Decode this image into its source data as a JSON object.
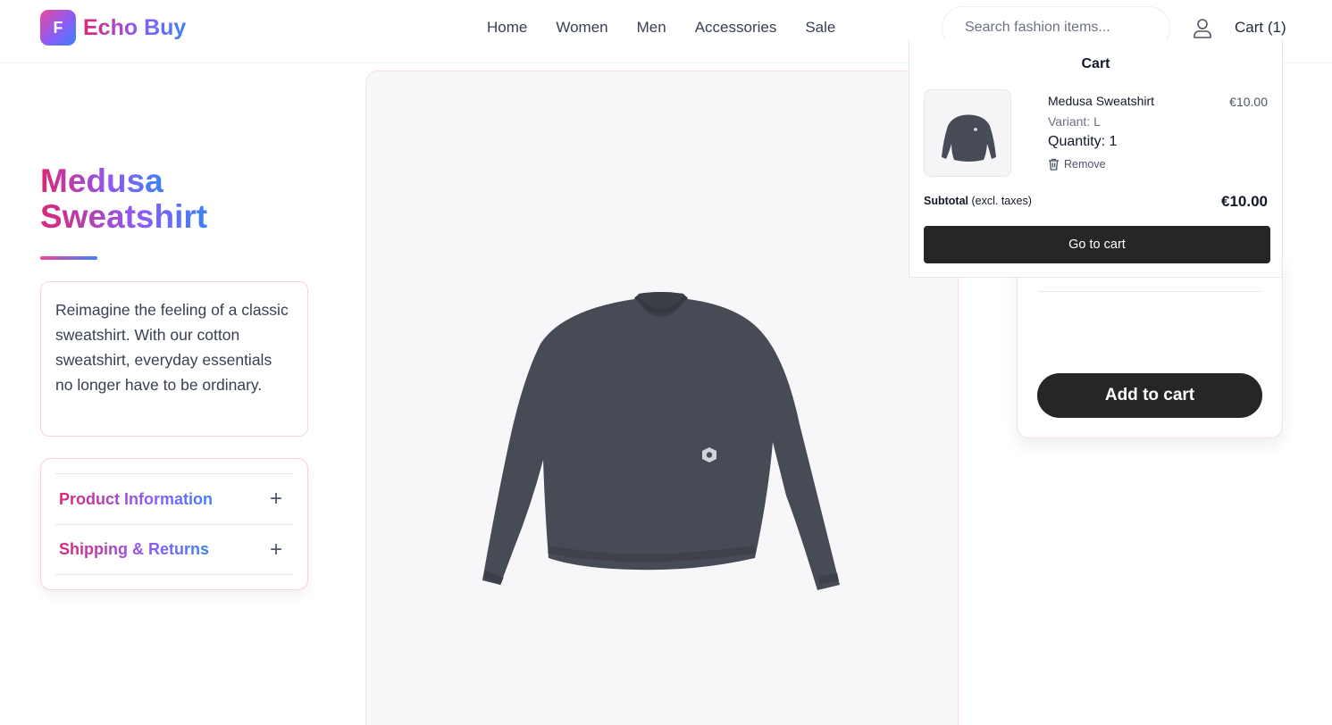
{
  "brand": {
    "initial": "F",
    "name": "Echo Buy"
  },
  "nav": [
    "Home",
    "Women",
    "Men",
    "Accessories",
    "Sale"
  ],
  "search": {
    "placeholder": "Search fashion items..."
  },
  "cart_link": "Cart (1)",
  "product": {
    "title_line1": "Medusa",
    "title_line2": "Sweatshirt",
    "description": "Reimagine the feeling of a classic sweatshirt. With our cotton sweatshirt, everyday essentials no longer have to be ordinary.",
    "accordion": [
      "Product Information",
      "Shipping & Returns"
    ],
    "add_to_cart": "Add to cart"
  },
  "cart_dropdown": {
    "title": "Cart",
    "item": {
      "name": "Medusa Sweatshirt",
      "price": "€10.00",
      "variant": "Variant: L",
      "quantity": "Quantity: 1",
      "remove": "Remove"
    },
    "subtotal_label": "Subtotal",
    "subtotal_note": "(excl. taxes)",
    "subtotal_value": "€10.00",
    "go_to_cart": "Go to cart"
  },
  "icons": {
    "user": "user-icon",
    "remove": "trash-icon",
    "expand": "plus-icon"
  },
  "colors": {
    "brand_pink": "#ec4899",
    "brand_violet": "#8b5cf6",
    "brand_blue": "#3b82f6",
    "button_dark": "#262626"
  }
}
